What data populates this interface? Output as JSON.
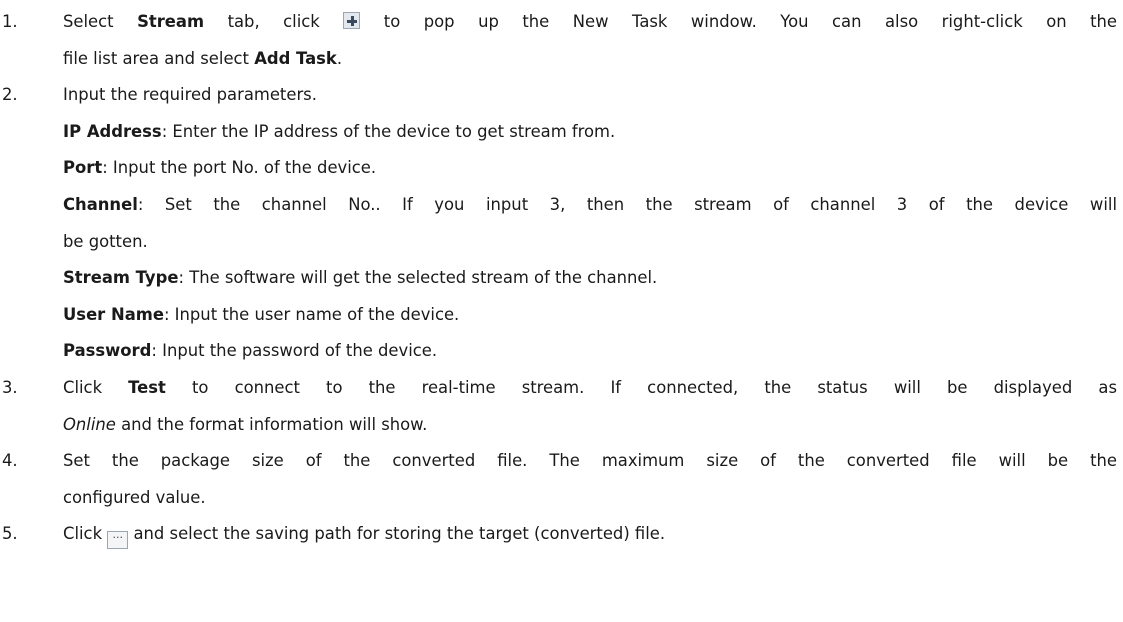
{
  "steps": [
    {
      "num": "1.",
      "l1": {
        "a": "Select ",
        "b": "Stream",
        "c": " tab, click ",
        "d": " to pop up the New Task window. You can also right-click on the"
      },
      "l2": {
        "a": "file list area and select ",
        "b": "Add Task",
        "c": "."
      }
    },
    {
      "num": "2.",
      "l1": "Input the required parameters."
    },
    {
      "num": "3.",
      "l1": {
        "a": "Click ",
        "b": "Test",
        "c": " to connect to the real-time stream. If connected, the status will be displayed as"
      },
      "l2": {
        "a": "Online",
        "b": " and the format information will show."
      }
    },
    {
      "num": "4.",
      "l1": "Set the package size of the converted file. The maximum size of the converted file will be the",
      "l2": "configured value."
    },
    {
      "num": "5.",
      "l1": {
        "a": "Click ",
        "b": " and select the saving path for storing the target (converted) file."
      }
    }
  ],
  "params": [
    {
      "term": "IP Address",
      "desc": ": Enter the IP address of the device to get stream from."
    },
    {
      "term": "Port",
      "desc": ": Input the port No. of the device."
    },
    {
      "term": "Channel",
      "desc": ": Set the channel No.. If you input 3, then the stream of channel 3 of the device will",
      "desc2": "be gotten."
    },
    {
      "term": "Stream Type",
      "desc": ": The software will get the selected stream of the channel."
    },
    {
      "term": "User Name",
      "desc": ": Input the user name of the device."
    },
    {
      "term": "Password",
      "desc": ": Input the password of the device."
    }
  ],
  "icons": {
    "add": "plus-icon",
    "browse": "more-icon"
  },
  "browse_glyph": "···"
}
